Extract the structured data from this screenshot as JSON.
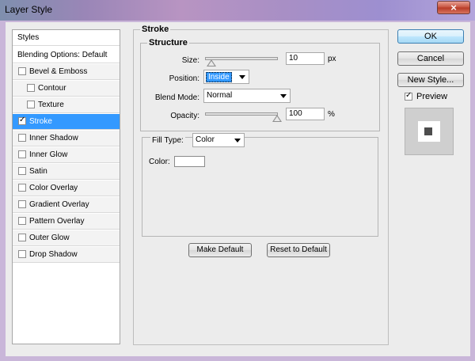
{
  "window": {
    "title": "Layer Style",
    "close_glyph": "×"
  },
  "styles_panel": {
    "header": "Styles",
    "blending_options": "Blending Options: Default",
    "items": [
      {
        "label": "Bevel & Emboss",
        "checked": false,
        "indent": false
      },
      {
        "label": "Contour",
        "checked": false,
        "indent": true
      },
      {
        "label": "Texture",
        "checked": false,
        "indent": true
      },
      {
        "label": "Stroke",
        "checked": true,
        "indent": false,
        "selected": true
      },
      {
        "label": "Inner Shadow",
        "checked": false,
        "indent": false
      },
      {
        "label": "Inner Glow",
        "checked": false,
        "indent": false
      },
      {
        "label": "Satin",
        "checked": false,
        "indent": false
      },
      {
        "label": "Color Overlay",
        "checked": false,
        "indent": false
      },
      {
        "label": "Gradient Overlay",
        "checked": false,
        "indent": false
      },
      {
        "label": "Pattern Overlay",
        "checked": false,
        "indent": false
      },
      {
        "label": "Outer Glow",
        "checked": false,
        "indent": false
      },
      {
        "label": "Drop Shadow",
        "checked": false,
        "indent": false
      }
    ]
  },
  "stroke": {
    "title": "Stroke",
    "structure": {
      "title": "Structure",
      "size_label": "Size:",
      "size_value": "10",
      "size_unit": "px",
      "position_label": "Position:",
      "position_value": "Inside",
      "blend_mode_label": "Blend Mode:",
      "blend_mode_value": "Normal",
      "opacity_label": "Opacity:",
      "opacity_value": "100",
      "opacity_unit": "%"
    },
    "fill": {
      "fill_type_label": "Fill Type:",
      "fill_type_value": "Color",
      "color_label": "Color:",
      "color_value": "#ffffff"
    },
    "make_default": "Make Default",
    "reset_to_default": "Reset to Default"
  },
  "buttons": {
    "ok": "OK",
    "cancel": "Cancel",
    "new_style": "New Style..."
  },
  "preview": {
    "label": "Preview",
    "checked": true
  }
}
